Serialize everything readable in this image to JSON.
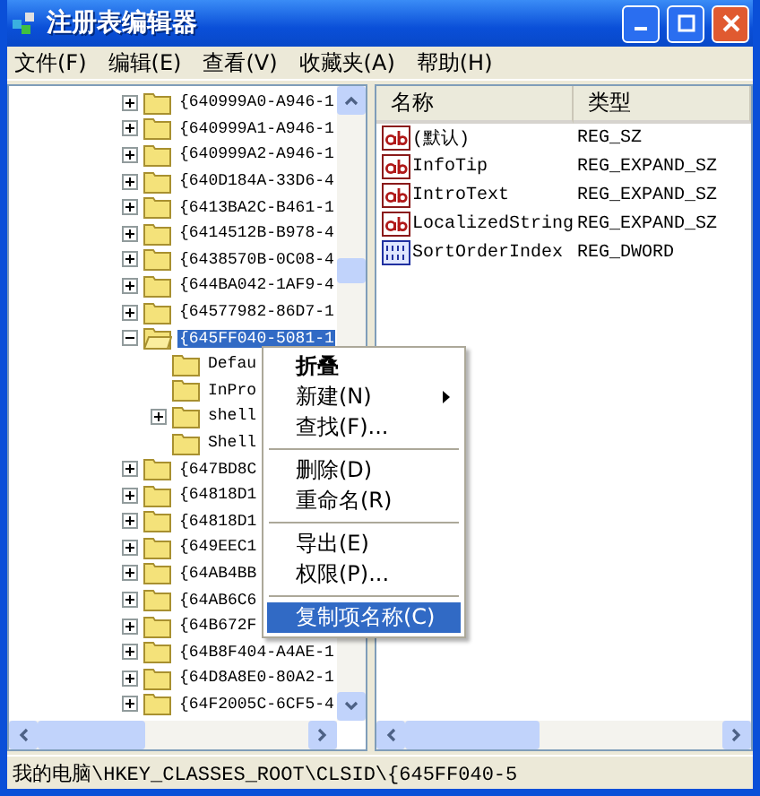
{
  "window": {
    "title": "注册表编辑器"
  },
  "menu": [
    "文件(F)",
    "编辑(E)",
    "查看(V)",
    "收藏夹(A)",
    "帮助(H)"
  ],
  "tree": [
    {
      "label": "{640999A0-A946-1",
      "expandable": true,
      "expanded": false,
      "selected": false
    },
    {
      "label": "{640999A1-A946-1",
      "expandable": true,
      "expanded": false,
      "selected": false
    },
    {
      "label": "{640999A2-A946-1",
      "expandable": true,
      "expanded": false,
      "selected": false
    },
    {
      "label": "{640D184A-33D6-4",
      "expandable": true,
      "expanded": false,
      "selected": false
    },
    {
      "label": "{6413BA2C-B461-1",
      "expandable": true,
      "expanded": false,
      "selected": false
    },
    {
      "label": "{6414512B-B978-4",
      "expandable": true,
      "expanded": false,
      "selected": false
    },
    {
      "label": "{6438570B-0C08-4",
      "expandable": true,
      "expanded": false,
      "selected": false
    },
    {
      "label": "{644BA042-1AF9-4",
      "expandable": true,
      "expanded": false,
      "selected": false
    },
    {
      "label": "{64577982-86D7-1",
      "expandable": true,
      "expanded": false,
      "selected": false
    },
    {
      "label": "{645FF040-5081-1",
      "expandable": true,
      "expanded": true,
      "selected": true,
      "children": [
        {
          "label": "Defau",
          "expandable": false,
          "expanded": false,
          "selected": false
        },
        {
          "label": "InPro",
          "expandable": false,
          "expanded": false,
          "selected": false
        },
        {
          "label": "shell",
          "expandable": true,
          "expanded": false,
          "selected": false
        },
        {
          "label": "Shell",
          "expandable": false,
          "expanded": false,
          "selected": false
        }
      ]
    },
    {
      "label": "{647BD8C",
      "expandable": true,
      "expanded": false,
      "selected": false
    },
    {
      "label": "{64818D1",
      "expandable": true,
      "expanded": false,
      "selected": false
    },
    {
      "label": "{64818D1",
      "expandable": true,
      "expanded": false,
      "selected": false
    },
    {
      "label": "{649EEC1",
      "expandable": true,
      "expanded": false,
      "selected": false
    },
    {
      "label": "{64AB4BB",
      "expandable": true,
      "expanded": false,
      "selected": false
    },
    {
      "label": "{64AB6C6",
      "expandable": true,
      "expanded": false,
      "selected": false
    },
    {
      "label": "{64B672F",
      "expandable": true,
      "expanded": false,
      "selected": false
    },
    {
      "label": "{64B8F404-A4AE-1",
      "expandable": true,
      "expanded": false,
      "selected": false
    },
    {
      "label": "{64D8A8E0-80A2-1",
      "expandable": true,
      "expanded": false,
      "selected": false
    },
    {
      "label": "{64F2005C-6CF5-4",
      "expandable": true,
      "expanded": false,
      "selected": false
    }
  ],
  "values": {
    "columns": [
      "名称",
      "类型"
    ],
    "rows": [
      {
        "kind": "string",
        "name": "(默认)",
        "type": "REG_SZ"
      },
      {
        "kind": "string",
        "name": "InfoTip",
        "type": "REG_EXPAND_SZ"
      },
      {
        "kind": "string",
        "name": "IntroText",
        "type": "REG_EXPAND_SZ"
      },
      {
        "kind": "string",
        "name": "LocalizedString",
        "type": "REG_EXPAND_SZ"
      },
      {
        "kind": "dword",
        "name": "SortOrderIndex",
        "type": "REG_DWORD"
      }
    ]
  },
  "context_menu": [
    {
      "kind": "item",
      "label": "折叠",
      "bold": true,
      "submenu": false,
      "selected": false
    },
    {
      "kind": "item",
      "label": "新建(N)",
      "bold": false,
      "submenu": true,
      "selected": false
    },
    {
      "kind": "item",
      "label": "查找(F)...",
      "bold": false,
      "submenu": false,
      "selected": false
    },
    {
      "kind": "separator"
    },
    {
      "kind": "item",
      "label": "删除(D)",
      "bold": false,
      "submenu": false,
      "selected": false
    },
    {
      "kind": "item",
      "label": "重命名(R)",
      "bold": false,
      "submenu": false,
      "selected": false
    },
    {
      "kind": "separator"
    },
    {
      "kind": "item",
      "label": "导出(E)",
      "bold": false,
      "submenu": false,
      "selected": false
    },
    {
      "kind": "item",
      "label": "权限(P)...",
      "bold": false,
      "submenu": false,
      "selected": false
    },
    {
      "kind": "separator"
    },
    {
      "kind": "item",
      "label": "复制项名称(C)",
      "bold": false,
      "submenu": false,
      "selected": true
    }
  ],
  "status_bar": "我的电脑\\HKEY_CLASSES_ROOT\\CLSID\\{645FF040-5"
}
